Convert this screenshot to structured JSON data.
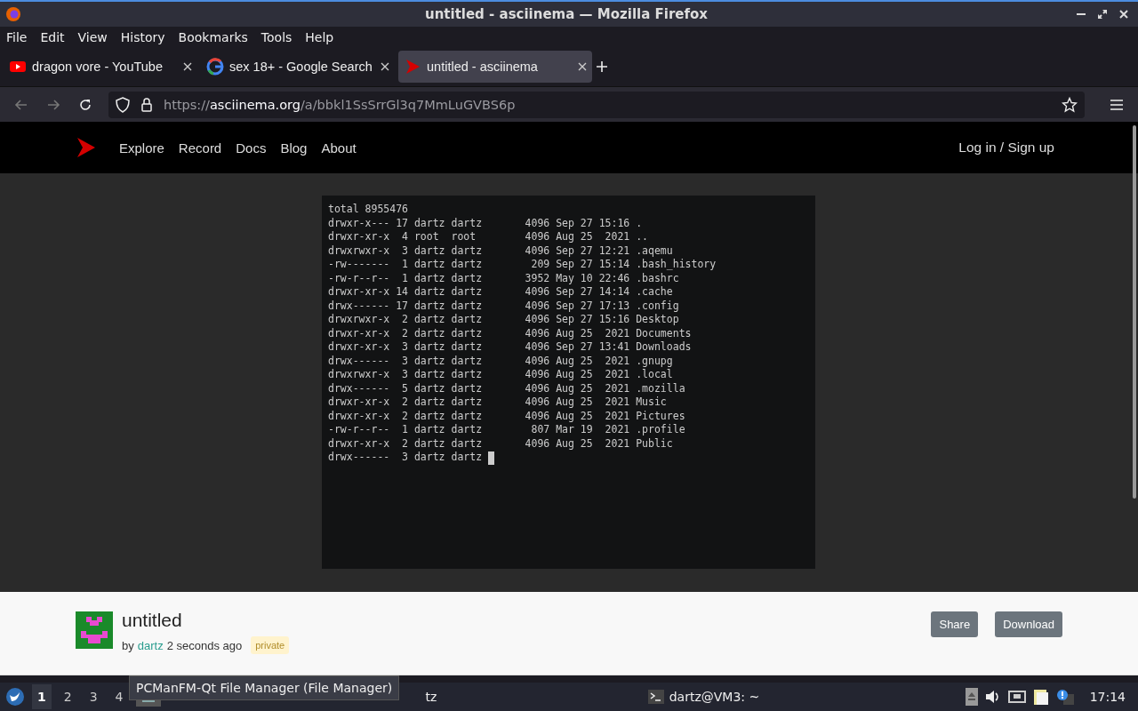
{
  "window": {
    "title": "untitled - asciinema — Mozilla Firefox"
  },
  "menu": [
    "File",
    "Edit",
    "View",
    "History",
    "Bookmarks",
    "Tools",
    "Help"
  ],
  "tabs": [
    {
      "label": "dragon vore - YouTube",
      "kind": "youtube",
      "selected": false
    },
    {
      "label": "sex 18+ - Google Search",
      "kind": "google",
      "selected": false
    },
    {
      "label": "untitled - asciinema",
      "kind": "asciinema",
      "selected": true
    }
  ],
  "address_bar": {
    "host": "asciinema.org",
    "prefix": "https://",
    "path": "/a/bbkl1SsSrrGl3q7MmLuGVBS6p"
  },
  "site_nav": {
    "links": [
      "Explore",
      "Record",
      "Docs",
      "Blog",
      "About"
    ],
    "account": "Log in / Sign up"
  },
  "terminal": {
    "lines": [
      "total 8955476",
      "drwxr-x--- 17 dartz dartz       4096 Sep 27 15:16 .",
      "drwxr-xr-x  4 root  root        4096 Aug 25  2021 ..",
      "drwxrwxr-x  3 dartz dartz       4096 Sep 27 12:21 .aqemu",
      "-rw-------  1 dartz dartz        209 Sep 27 15:14 .bash_history",
      "-rw-r--r--  1 dartz dartz       3952 May 10 22:46 .bashrc",
      "drwxr-xr-x 14 dartz dartz       4096 Sep 27 14:14 .cache",
      "drwx------ 17 dartz dartz       4096 Sep 27 17:13 .config",
      "drwxrwxr-x  2 dartz dartz       4096 Sep 27 15:16 Desktop",
      "drwxr-xr-x  2 dartz dartz       4096 Aug 25  2021 Documents",
      "drwxr-xr-x  3 dartz dartz       4096 Sep 27 13:41 Downloads",
      "drwx------  3 dartz dartz       4096 Aug 25  2021 .gnupg",
      "drwxrwxr-x  3 dartz dartz       4096 Aug 25  2021 .local",
      "drwx------  5 dartz dartz       4096 Aug 25  2021 .mozilla",
      "drwxr-xr-x  2 dartz dartz       4096 Aug 25  2021 Music",
      "drwxr-xr-x  2 dartz dartz       4096 Aug 25  2021 Pictures",
      "-rw-r--r--  1 dartz dartz        807 Mar 19  2021 .profile",
      "drwxr-xr-x  2 dartz dartz       4096 Aug 25  2021 Public",
      "drwx------  3 dartz dartz "
    ]
  },
  "recording": {
    "title": "untitled",
    "by": "by",
    "author": "dartz",
    "age": "2 seconds ago",
    "visibility": "private",
    "buttons": [
      "Share",
      "Download"
    ]
  },
  "taskbar": {
    "desktops": [
      {
        "label": "1",
        "selected": true
      },
      {
        "label": "2",
        "selected": false
      },
      {
        "label": "3",
        "selected": false
      },
      {
        "label": "4",
        "selected": false
      }
    ],
    "tooltip": "PCManFM-Qt File Manager (File Manager)",
    "partial_task": "tz",
    "terminal_task": "dartz@VM3: ~",
    "clock": "17:14"
  }
}
